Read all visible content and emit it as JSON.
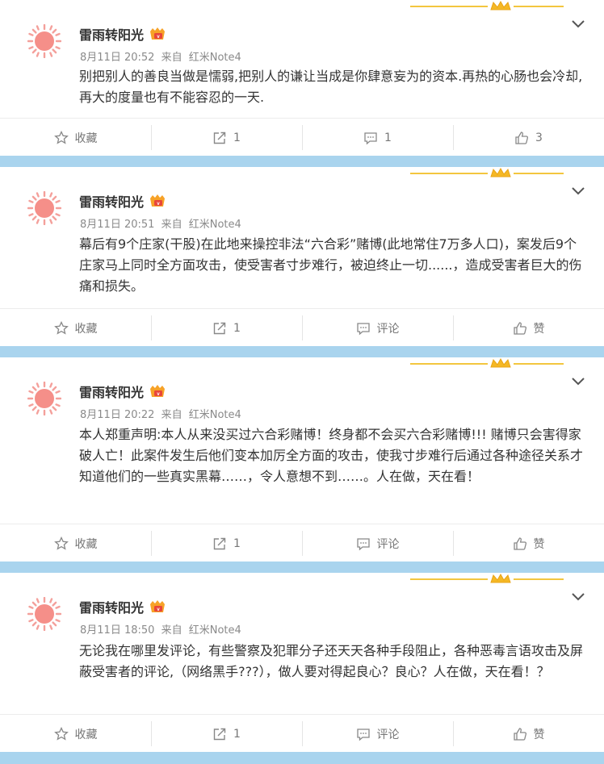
{
  "colors": {
    "background": "#a9d4ee",
    "accent_gold": "#f3c63f",
    "avatar_sun": "#f4a09b"
  },
  "icons": {
    "avatar": "sun-avatar",
    "badge": "vip-badge-icon",
    "menu": "chevron-down-icon",
    "fav": "star-icon",
    "repost": "repost-icon",
    "comment": "comment-icon",
    "like": "thumbs-up-icon"
  },
  "posts": [
    {
      "user": "雷雨转阳光",
      "date": "8月11日 20:52",
      "via_label": "来自",
      "device": "红米Note4",
      "text": "别把别人的善良当做是懦弱,把别人的谦让当成是你肆意妄为的资本.再热的心肠也会冷却,再大的度量也有不能容忍的一天.",
      "fav_label": "收藏",
      "repost_count": "1",
      "comment_label": "1",
      "like_label": "3"
    },
    {
      "user": "雷雨转阳光",
      "date": "8月11日 20:51",
      "via_label": "来自",
      "device": "红米Note4",
      "text": "幕后有9个庄家(干股)在此地来操控非法“六合彩”赌博(此地常住7万多人口)，案发后9个庄家马上同时全方面攻击，使受害者寸步难行，被迫终止一切......，造成受害者巨大的伤痛和损失。",
      "fav_label": "收藏",
      "repost_count": "1",
      "comment_label": "评论",
      "like_label": "赞"
    },
    {
      "user": "雷雨转阳光",
      "date": "8月11日 20:22",
      "via_label": "来自",
      "device": "红米Note4",
      "text": "本人郑重声明:本人从来没买过六合彩赌博！终身都不会买六合彩赌博!!! 赌博只会害得家破人亡！此案件发生后他们变本加厉全方面的攻击，使我寸步难行后通过各种途径关系才知道他们的一些真实黑幕……，令人意想不到……。人在做，天在看！",
      "fav_label": "收藏",
      "repost_count": "1",
      "comment_label": "评论",
      "like_label": "赞"
    },
    {
      "user": "雷雨转阳光",
      "date": "8月11日 18:50",
      "via_label": "来自",
      "device": "红米Note4",
      "text": "无论我在哪里发评论，有些警察及犯罪分子还天天各种手段阻止，各种恶毒言语攻击及屏蔽受害者的评论,（网络黑手???），做人要对得起良心？良心？人在做，天在看！？",
      "fav_label": "收藏",
      "repost_count": "1",
      "comment_label": "评论",
      "like_label": "赞"
    }
  ]
}
